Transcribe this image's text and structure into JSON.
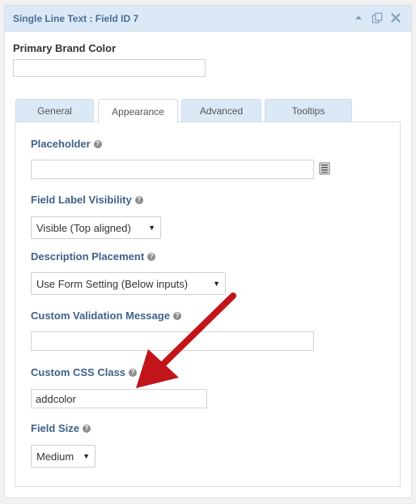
{
  "panel": {
    "title": "Single Line Text : Field ID 7",
    "icons": [
      "collapse-up-icon",
      "duplicate-icon",
      "close-icon"
    ]
  },
  "field": {
    "label": "Primary Brand Color",
    "value": ""
  },
  "tabs": [
    {
      "label": "General",
      "active": false
    },
    {
      "label": "Appearance",
      "active": true
    },
    {
      "label": "Advanced",
      "active": false
    },
    {
      "label": "Tooltips",
      "active": false
    }
  ],
  "settings": {
    "placeholder": {
      "label": "Placeholder",
      "value": ""
    },
    "label_visibility": {
      "label": "Field Label Visibility",
      "selected": "Visible (Top aligned)"
    },
    "description_placement": {
      "label": "Description Placement",
      "selected": "Use Form Setting (Below inputs)"
    },
    "validation_message": {
      "label": "Custom Validation Message",
      "value": ""
    },
    "css_class": {
      "label": "Custom CSS Class",
      "value": "addcolor"
    },
    "field_size": {
      "label": "Field Size",
      "selected": "Medium"
    }
  },
  "help_glyph": "?",
  "caret_glyph": "▼",
  "colors": {
    "header_bg": "#dbe9f7",
    "title": "#4a6d95",
    "label": "#3f6189",
    "arrow": "#c1151a"
  }
}
